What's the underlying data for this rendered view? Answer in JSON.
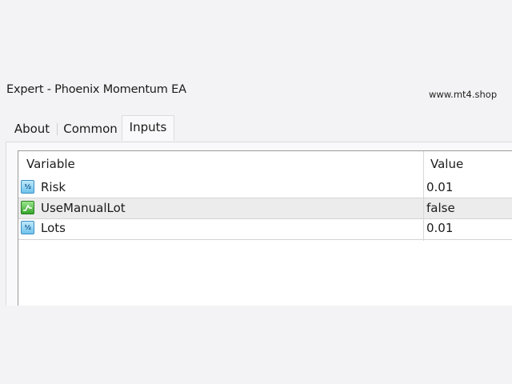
{
  "window": {
    "title": "Expert - Phoenix Momentum EA",
    "watermark": "www.mt4.shop"
  },
  "tabs": [
    {
      "label": "About"
    },
    {
      "label": "Common"
    },
    {
      "label": "Inputs",
      "active": true
    }
  ],
  "table": {
    "headers": {
      "variable": "Variable",
      "value": "Value"
    },
    "rows": [
      {
        "icon": "numeric-icon",
        "icon_text": "½",
        "variable": "Risk",
        "value": "0.01"
      },
      {
        "icon": "boolean-icon",
        "variable": "UseManualLot",
        "value": "false",
        "selected": true
      },
      {
        "icon": "numeric-icon",
        "icon_text": "½",
        "variable": "Lots",
        "value": "0.01"
      }
    ]
  },
  "colors": {
    "background": "#f3f3f5",
    "grid_background": "#ffffff",
    "selected_row": "#ececec",
    "numeric_icon": "#6fc3ec",
    "boolean_icon": "#35a52a"
  }
}
